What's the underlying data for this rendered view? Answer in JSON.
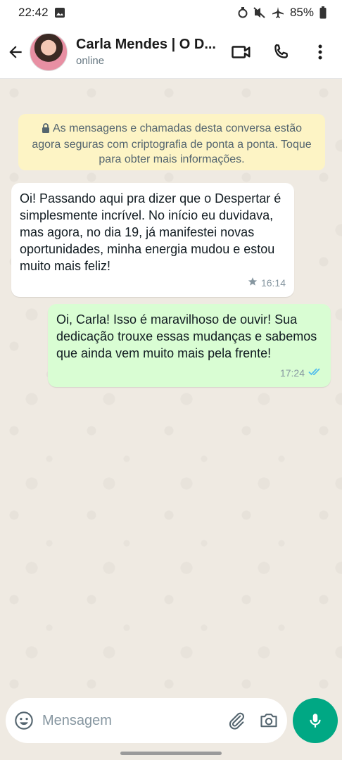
{
  "status_bar": {
    "time": "22:42",
    "battery": "85%",
    "icons": [
      "image-icon",
      "data-saver-icon",
      "mute-vibrate-icon",
      "airplane-icon",
      "battery-icon"
    ]
  },
  "header": {
    "contact_name": "Carla Mendes | O D...",
    "status": "online",
    "icons": [
      "back-arrow-icon",
      "video-call-icon",
      "phone-icon",
      "more-vert-icon"
    ]
  },
  "chat": {
    "encryption_notice": "As mensagens e chamadas desta conversa estão agora seguras com criptografia de ponta a ponta. Toque para obter mais informações.",
    "messages": [
      {
        "direction": "incoming",
        "text": "Oi! Passando aqui pra dizer que o Despertar é simplesmente incrível. No início eu duvidava, mas agora, no dia 19, já manifestei novas oportunidades, minha energia mudou e estou muito mais feliz!",
        "time": "16:14",
        "starred": true
      },
      {
        "direction": "outgoing",
        "text": "Oi, Carla! Isso é maravilhoso de ouvir! Sua dedicação trouxe essas mudanças e sabemos que ainda vem muito mais pela frente!",
        "time": "17:24",
        "read": true
      }
    ]
  },
  "composer": {
    "placeholder": "Mensagem",
    "icons": [
      "emoji-icon",
      "attach-icon",
      "camera-icon",
      "mic-icon"
    ]
  },
  "colors": {
    "accent": "#00a884",
    "outgoing_bubble": "#d9fdd3",
    "notice_bg": "#fdf4c5",
    "read_ticks": "#53bdeb"
  }
}
